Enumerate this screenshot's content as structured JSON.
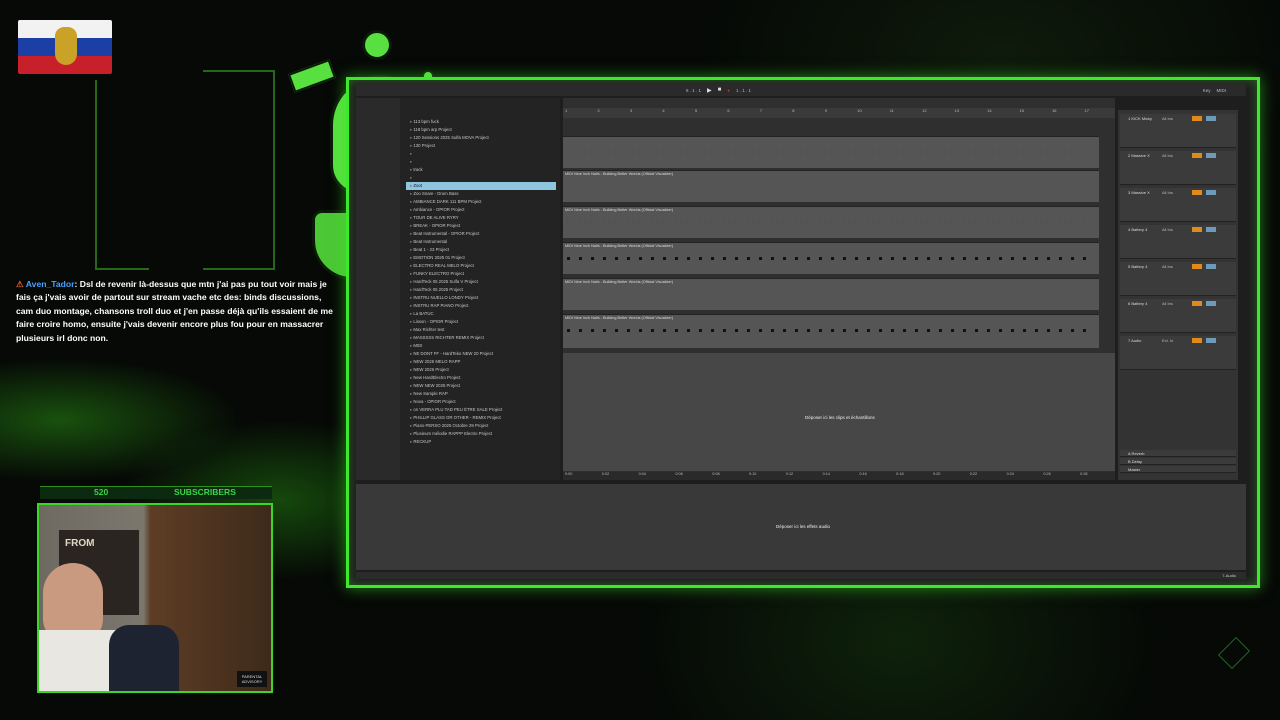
{
  "chat": {
    "username": "Aven_Tador",
    "message": ": Dsl de revenir là-dessus que mtn j'ai pas pu tout voir mais je fais ça j'vais avoir de partout sur stream vache etc des: binds discussions, cam duo montage, chansons troll duo et j'en passe déjà qu'ils essaient de me faire croire homo, ensuite j'vais devenir encore plus fou pour en massacrer plusieurs irl donc non."
  },
  "subscribers": {
    "count": "520",
    "label": "SUBSCRIBERS"
  },
  "webcam": {
    "poster_text": "FROM",
    "badge_text": "PARENTAL ADVISORY"
  },
  "daw": {
    "topbar": {
      "tempo": "6 . 1 . 1",
      "position": "1 . 1 . 1",
      "key": "Key",
      "midi": "MIDI"
    },
    "browser_items": [
      "113 bpm fuck",
      "118 bpm arp Project",
      "120 Sessions 2025 Sulfa MOVA Project",
      "130 Project",
      "",
      "",
      "track",
      "",
      "Zoot",
      "Zoo Snare - Drum Bass",
      "AMBIANCE DARK 111 BPM Project",
      "Ambiance - OPIOR Project",
      "TOUR DE ALIVE RYRY",
      "BREAK - OPIOR Project",
      "Beat Instrumental - OPIOR Project",
      "Beat Instrumental",
      "Beat 1 - 23 Project",
      "EMOTION 2025 01 Project",
      "ELECTRO REAL MELO Project",
      "FUNKY ELECTRO Project",
      "HardTeck 05 2025 Sulfa V Project",
      "HardTeck 05 2025 Project",
      "INSTRU NUELLO LONDY Project",
      "INSTRU RAP PIANO Project",
      "La BATUC",
      "Lisson - OPIOR Project",
      "Max Richter test",
      "MASSSSS RICHTER REMIX Project",
      "MIDI",
      "NE DONT FF - HardTeko NEW 20 Project",
      "NEW 2025 MELO RAPP",
      "NEW 2026 Project",
      "New HardElectro Project",
      "NEW NEW 2025 Project",
      "New Sample RAP",
      "Nova - OPIOR Project",
      "on VERRA PLU TAD PEU ÉTRE SALE Project",
      "PHILLIP GLASS OR OTHER - REMIX Project",
      "Piano PERSO 2025 Octobre 29 Project",
      "Plusieurs mélodie RAPPP Electro Project",
      "RECKUP"
    ],
    "selected_item": "Zoot",
    "ruler": [
      "1",
      "2",
      "3",
      "4",
      "5",
      "6",
      "7",
      "8",
      "9",
      "10",
      "11",
      "12",
      "13",
      "14",
      "15",
      "16",
      "17"
    ],
    "tracks": [
      {
        "label": ""
      },
      {
        "label": "MIDI Nine Inch Nails - Building Better Worlds (Official Visualizer)"
      },
      {
        "label": "MIDI Nine Inch Nails - Building Better Worlds (Official Visualizer)"
      },
      {
        "label": "MIDI Nine Inch Nails - Building Better Worlds (Official Visualizer)"
      },
      {
        "label": "MIDI Nine Inch Nails - Building Better Worlds (Official Visualizer)"
      },
      {
        "label": "MIDI Nine Inch Nails - Building Better Worlds (Official Visualizer)"
      }
    ],
    "drop_clips_text": "Déposer ici les clips et échantillons",
    "timeline": [
      "0:00",
      "0:02",
      "0:04",
      "0:06",
      "0:08",
      "0:10",
      "0:12",
      "0:14",
      "0:16",
      "0:18",
      "0:20",
      "0:22",
      "0:24",
      "0:26",
      "0:28"
    ],
    "mixer_strips": [
      {
        "name": "1 KICK Micky",
        "io": "All Ins"
      },
      {
        "name": "2 Massive X",
        "io": "All Ins"
      },
      {
        "name": "3 Massive X",
        "io": "All Ins"
      },
      {
        "name": "4 Battery 4",
        "io": "All Ins"
      },
      {
        "name": "5 Battery 4",
        "io": "All Ins"
      },
      {
        "name": "6 Battery 4",
        "io": "All Ins"
      },
      {
        "name": "7 Audio",
        "io": "Ext. In"
      }
    ],
    "return_tracks": [
      "A Reverb",
      "B Delay",
      "Master"
    ],
    "drop_effects_text": "Déposer ici les effets audio",
    "status_right": "7-Audio"
  }
}
